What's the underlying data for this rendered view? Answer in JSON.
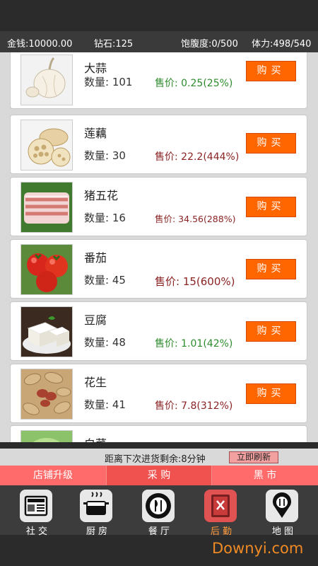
{
  "status": {
    "money": "金钱:10000.00",
    "diamonds": "钻石:125",
    "satiety": "饱腹度:0/500",
    "stamina": "体力:498/540"
  },
  "buy_label": "购买",
  "items": [
    {
      "name": "大蒜",
      "qty": "数量: 101",
      "price": "售价: 0.25(25%)",
      "price_color": "#2e8b2e"
    },
    {
      "name": "莲藕",
      "qty": "数量: 30",
      "price": "售价: 22.2(444%)",
      "price_color": "#8b2323"
    },
    {
      "name": "猪五花",
      "qty": "数量: 16",
      "price": "售价: 34.56(288%)",
      "price_color": "#8b2323"
    },
    {
      "name": "番茄",
      "qty": "数量: 45",
      "price": "售价: 15(600%)",
      "price_color": "#8b2323"
    },
    {
      "name": "豆腐",
      "qty": "数量: 48",
      "price": "售价: 1.01(42%)",
      "price_color": "#2e8b2e"
    },
    {
      "name": "花生",
      "qty": "数量: 41",
      "price": "售价: 7.8(312%)",
      "price_color": "#8b2323"
    },
    {
      "name": "白菜",
      "qty": "",
      "price": "",
      "price_color": "#333333"
    }
  ],
  "refresh": {
    "text": "距离下次进货剩余:8分钟",
    "button": "立即刷新"
  },
  "tabs": [
    "店铺升级",
    "采 购",
    "黑 市"
  ],
  "nav": [
    {
      "label": "社 交",
      "icon": "newspaper-icon"
    },
    {
      "label": "厨 房",
      "icon": "pot-icon"
    },
    {
      "label": "餐 厅",
      "icon": "plate-icon"
    },
    {
      "label": "后 勤",
      "icon": "notebook-icon"
    },
    {
      "label": "地 图",
      "icon": "map-pin-icon"
    }
  ],
  "watermark": "Downyi.com",
  "colors": {
    "accent": "#ff6600",
    "tab_bar": "#ff6b6b",
    "active_nav": "#e15252"
  }
}
